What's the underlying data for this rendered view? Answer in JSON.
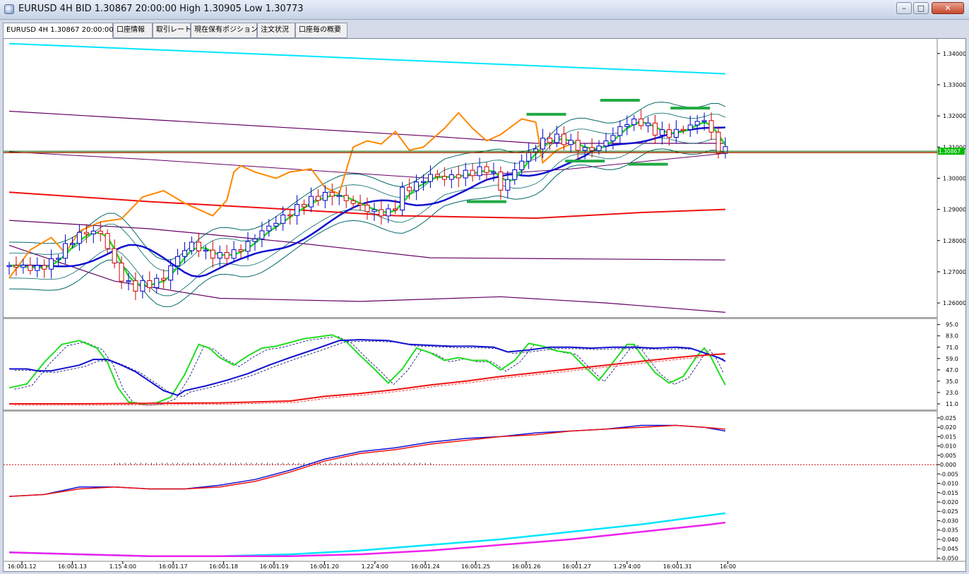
{
  "window": {
    "title": "EURUSD 4H BID 1.30867 20:00:00 High 1.30905 Low 1.30773",
    "minimize": "–",
    "maximize": "□",
    "close": "✕"
  },
  "tabs": [
    {
      "label": "EURUSD 4H 1.30867 20:00:00",
      "active": true
    },
    {
      "label": "口座情報",
      "active": false
    },
    {
      "label": "取引レート",
      "active": false
    },
    {
      "label": "現在保有ポジション",
      "active": false
    },
    {
      "label": "注文状況",
      "active": false
    },
    {
      "label": "口座毎の概要",
      "active": false
    }
  ],
  "colors": {
    "candle_up": "#0000cc",
    "candle_down": "#cc0000",
    "ma_fast": "#22dd22",
    "ma_mid": "#1010d0",
    "ma_slow": "#ee1111",
    "bb": "#006666",
    "bb_outer": "#660066",
    "cyan": "#00e5ff",
    "orange": "#ff8800",
    "signal": "#22aa44",
    "price_line": "#006600",
    "grid": "#c0c0c0"
  },
  "chart_data": [
    {
      "type": "candlestick",
      "title": "EURUSD 4H",
      "y_ticks": [
        "1.34000",
        "1.33000",
        "1.32000",
        "1.31000",
        "1.30000",
        "1.29000",
        "1.28000",
        "1.27000",
        "1.26000"
      ],
      "ylim": [
        1.2555,
        1.3438
      ],
      "current_price": "1.30867",
      "x_ticks": [
        "16:001.12",
        "16:001.13",
        "1.15 4:00",
        "16:001.17",
        "16:001.18",
        "16:001.19",
        "16:001.20",
        "1.22 4:00",
        "16:001.24",
        "16:001.25",
        "16:001.26",
        "16:001.27",
        "1.29 4:00",
        "16:001.31",
        "16:00"
      ],
      "close_path": [
        [
          0,
          1.272
        ],
        [
          8,
          1.271
        ],
        [
          12,
          1.273
        ],
        [
          16,
          1.278
        ],
        [
          20,
          1.282
        ],
        [
          24,
          1.283
        ],
        [
          26,
          1.282
        ],
        [
          28,
          1.278
        ],
        [
          30,
          1.272
        ],
        [
          32,
          1.268
        ],
        [
          34,
          1.266
        ],
        [
          36,
          1.265
        ],
        [
          38,
          1.266
        ],
        [
          40,
          1.266
        ],
        [
          44,
          1.268
        ],
        [
          48,
          1.275
        ],
        [
          52,
          1.279
        ],
        [
          56,
          1.276
        ],
        [
          60,
          1.275
        ],
        [
          64,
          1.276
        ],
        [
          68,
          1.279
        ],
        [
          72,
          1.283
        ],
        [
          76,
          1.286
        ],
        [
          80,
          1.289
        ],
        [
          84,
          1.292
        ],
        [
          88,
          1.294
        ],
        [
          92,
          1.295
        ],
        [
          96,
          1.293
        ],
        [
          100,
          1.291
        ],
        [
          104,
          1.289
        ],
        [
          108,
          1.289
        ],
        [
          110,
          1.291
        ],
        [
          112,
          1.296
        ],
        [
          116,
          1.298
        ],
        [
          120,
          1.301
        ],
        [
          124,
          1.3
        ],
        [
          128,
          1.301
        ],
        [
          132,
          1.302
        ],
        [
          136,
          1.303
        ],
        [
          138,
          1.301
        ],
        [
          140,
          1.297
        ],
        [
          142,
          1.299
        ],
        [
          144,
          1.303
        ],
        [
          148,
          1.308
        ],
        [
          152,
          1.312
        ],
        [
          156,
          1.313
        ],
        [
          160,
          1.311
        ],
        [
          164,
          1.309
        ],
        [
          168,
          1.31
        ],
        [
          172,
          1.314
        ],
        [
          176,
          1.318
        ],
        [
          180,
          1.318
        ],
        [
          184,
          1.315
        ],
        [
          188,
          1.314
        ],
        [
          192,
          1.316
        ],
        [
          196,
          1.318
        ],
        [
          198,
          1.319
        ],
        [
          200,
          1.314
        ],
        [
          202,
          1.309
        ],
        [
          204,
          1.309
        ]
      ]
    },
    {
      "type": "line",
      "title": "",
      "y_ticks": [
        "95.0",
        "83.0",
        "71.0",
        "59.0",
        "47.0",
        "35.0",
        "23.0",
        "11.0"
      ],
      "ylim": [
        5,
        100
      ],
      "series": [
        {
          "color": "#22dd22",
          "points": [
            [
              0,
              28
            ],
            [
              5,
              32
            ],
            [
              10,
              55
            ],
            [
              15,
              74
            ],
            [
              20,
              78
            ],
            [
              25,
              70
            ],
            [
              28,
              55
            ],
            [
              31,
              28
            ],
            [
              34,
              13
            ],
            [
              38,
              11
            ],
            [
              42,
              12
            ],
            [
              46,
              18
            ],
            [
              50,
              42
            ],
            [
              54,
              74
            ],
            [
              57,
              70
            ],
            [
              60,
              60
            ],
            [
              64,
              52
            ],
            [
              68,
              62
            ],
            [
              72,
              70
            ],
            [
              76,
              72
            ],
            [
              80,
              76
            ],
            [
              84,
              80
            ],
            [
              88,
              82
            ],
            [
              92,
              84
            ],
            [
              96,
              77
            ],
            [
              100,
              62
            ],
            [
              104,
              48
            ],
            [
              108,
              33
            ],
            [
              112,
              48
            ],
            [
              116,
              70
            ],
            [
              120,
              65
            ],
            [
              124,
              57
            ],
            [
              128,
              60
            ],
            [
              132,
              57
            ],
            [
              136,
              57
            ],
            [
              140,
              47
            ],
            [
              144,
              57
            ],
            [
              148,
              75
            ],
            [
              152,
              72
            ],
            [
              156,
              67
            ],
            [
              160,
              65
            ],
            [
              164,
              50
            ],
            [
              168,
              36
            ],
            [
              172,
              55
            ],
            [
              176,
              74
            ],
            [
              178,
              74
            ],
            [
              180,
              63
            ],
            [
              184,
              44
            ],
            [
              188,
              33
            ],
            [
              192,
              40
            ],
            [
              196,
              62
            ],
            [
              198,
              70
            ],
            [
              200,
              60
            ],
            [
              202,
              45
            ],
            [
              204,
              31
            ]
          ]
        },
        {
          "color": "#1010d0",
          "points": [
            [
              0,
              48
            ],
            [
              5,
              48
            ],
            [
              8,
              46
            ],
            [
              12,
              46
            ],
            [
              16,
              49
            ],
            [
              20,
              52
            ],
            [
              24,
              58
            ],
            [
              28,
              58
            ],
            [
              32,
              52
            ],
            [
              36,
              45
            ],
            [
              40,
              35
            ],
            [
              44,
              25
            ],
            [
              48,
              20
            ],
            [
              50,
              25
            ],
            [
              56,
              30
            ],
            [
              62,
              36
            ],
            [
              68,
              43
            ],
            [
              74,
              52
            ],
            [
              80,
              60
            ],
            [
              88,
              70
            ],
            [
              94,
              78
            ],
            [
              100,
              79
            ],
            [
              108,
              78
            ],
            [
              114,
              74
            ],
            [
              120,
              73
            ],
            [
              126,
              72
            ],
            [
              132,
              72
            ],
            [
              138,
              71
            ],
            [
              142,
              66
            ],
            [
              148,
              68
            ],
            [
              154,
              71
            ],
            [
              160,
              71
            ],
            [
              166,
              70
            ],
            [
              172,
              71
            ],
            [
              178,
              71
            ],
            [
              184,
              70
            ],
            [
              190,
              71
            ],
            [
              194,
              70
            ],
            [
              198,
              65
            ],
            [
              202,
              60
            ],
            [
              204,
              56
            ]
          ]
        },
        {
          "color": "#ee1111",
          "points": [
            [
              0,
              11
            ],
            [
              20,
              11
            ],
            [
              40,
              11.5
            ],
            [
              60,
              12
            ],
            [
              80,
              14
            ],
            [
              90,
              19
            ],
            [
              100,
              22
            ],
            [
              110,
              26
            ],
            [
              120,
              31
            ],
            [
              130,
              35
            ],
            [
              140,
              40
            ],
            [
              150,
              44
            ],
            [
              160,
              48
            ],
            [
              170,
              52
            ],
            [
              180,
              56
            ],
            [
              190,
              60
            ],
            [
              196,
              62
            ],
            [
              204,
              64
            ]
          ]
        }
      ]
    },
    {
      "type": "line",
      "title": "",
      "y_ticks": [
        "0.025",
        "0.020",
        "0.015",
        "0.010",
        "0.005",
        "0.000",
        "-0.005",
        "-0.010",
        "-0.015",
        "-0.020",
        "-0.025",
        "-0.030",
        "-0.035",
        "-0.040",
        "-0.045",
        "-0.050"
      ],
      "ylim": [
        -0.051,
        0.028
      ],
      "series": [
        {
          "color": "#1010d0",
          "points": [
            [
              0,
              -0.017
            ],
            [
              10,
              -0.016
            ],
            [
              20,
              -0.012
            ],
            [
              30,
              -0.012
            ],
            [
              40,
              -0.013
            ],
            [
              50,
              -0.013
            ],
            [
              60,
              -0.011
            ],
            [
              70,
              -0.008
            ],
            [
              80,
              -0.003
            ],
            [
              90,
              0.003
            ],
            [
              100,
              0.007
            ],
            [
              110,
              0.009
            ],
            [
              120,
              0.012
            ],
            [
              130,
              0.014
            ],
            [
              140,
              0.015
            ],
            [
              150,
              0.017
            ],
            [
              160,
              0.018
            ],
            [
              170,
              0.019
            ],
            [
              180,
              0.021
            ],
            [
              190,
              0.021
            ],
            [
              198,
              0.02
            ],
            [
              204,
              0.018
            ]
          ]
        },
        {
          "color": "#ee1111",
          "points": [
            [
              0,
              -0.017
            ],
            [
              10,
              -0.016
            ],
            [
              20,
              -0.013
            ],
            [
              30,
              -0.012
            ],
            [
              40,
              -0.013
            ],
            [
              50,
              -0.013
            ],
            [
              60,
              -0.012
            ],
            [
              70,
              -0.009
            ],
            [
              80,
              -0.004
            ],
            [
              90,
              0.002
            ],
            [
              100,
              0.006
            ],
            [
              110,
              0.008
            ],
            [
              120,
              0.011
            ],
            [
              130,
              0.013
            ],
            [
              140,
              0.015
            ],
            [
              150,
              0.016
            ],
            [
              160,
              0.018
            ],
            [
              170,
              0.019
            ],
            [
              180,
              0.02
            ],
            [
              190,
              0.021
            ],
            [
              198,
              0.02
            ],
            [
              204,
              0.019
            ]
          ]
        },
        {
          "color": "#00e5ff",
          "points": [
            [
              0,
              -0.047
            ],
            [
              20,
              -0.048
            ],
            [
              40,
              -0.049
            ],
            [
              60,
              -0.049
            ],
            [
              80,
              -0.048
            ],
            [
              100,
              -0.046
            ],
            [
              120,
              -0.043
            ],
            [
              140,
              -0.04
            ],
            [
              160,
              -0.036
            ],
            [
              180,
              -0.032
            ],
            [
              200,
              -0.027
            ],
            [
              204,
              -0.026
            ]
          ]
        },
        {
          "color": "#ee22ee",
          "points": [
            [
              0,
              -0.047
            ],
            [
              20,
              -0.048
            ],
            [
              40,
              -0.049
            ],
            [
              60,
              -0.049
            ],
            [
              80,
              -0.049
            ],
            [
              100,
              -0.048
            ],
            [
              120,
              -0.046
            ],
            [
              140,
              -0.043
            ],
            [
              160,
              -0.04
            ],
            [
              180,
              -0.036
            ],
            [
              200,
              -0.032
            ],
            [
              204,
              -0.031
            ]
          ]
        }
      ]
    }
  ]
}
